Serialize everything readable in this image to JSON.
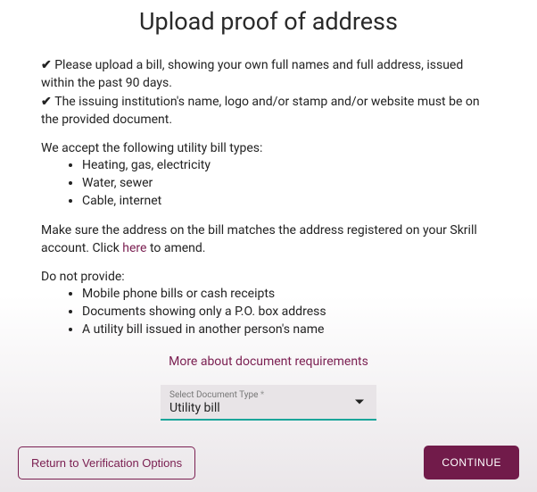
{
  "title": "Upload proof of address",
  "checks": [
    "Please upload a bill, showing your own full names and full address, issued within the past 90 days.",
    "The issuing institution's name, logo and/or stamp and/or website must be on the provided document."
  ],
  "accept_heading": "We accept the following utility bill types:",
  "accept_items": [
    "Heating, gas, electricity",
    "Water, sewer",
    "Cable, internet"
  ],
  "match_text_1": "Make sure the address on the bill matches the address registered on your Skrill account. Click ",
  "match_link": "here",
  "match_text_2": " to amend.",
  "do_not_heading": "Do not provide:",
  "do_not_items": [
    "Mobile phone bills or cash receipts",
    "Documents showing only a P.O. box address",
    "A utility bill issued in another person's name"
  ],
  "more_info": "More about document requirements",
  "select": {
    "label": "Select Document Type",
    "required_mark": "*",
    "value": "Utility bill"
  },
  "buttons": {
    "return": "Return to Verification Options",
    "continue": "CONTINUE"
  }
}
